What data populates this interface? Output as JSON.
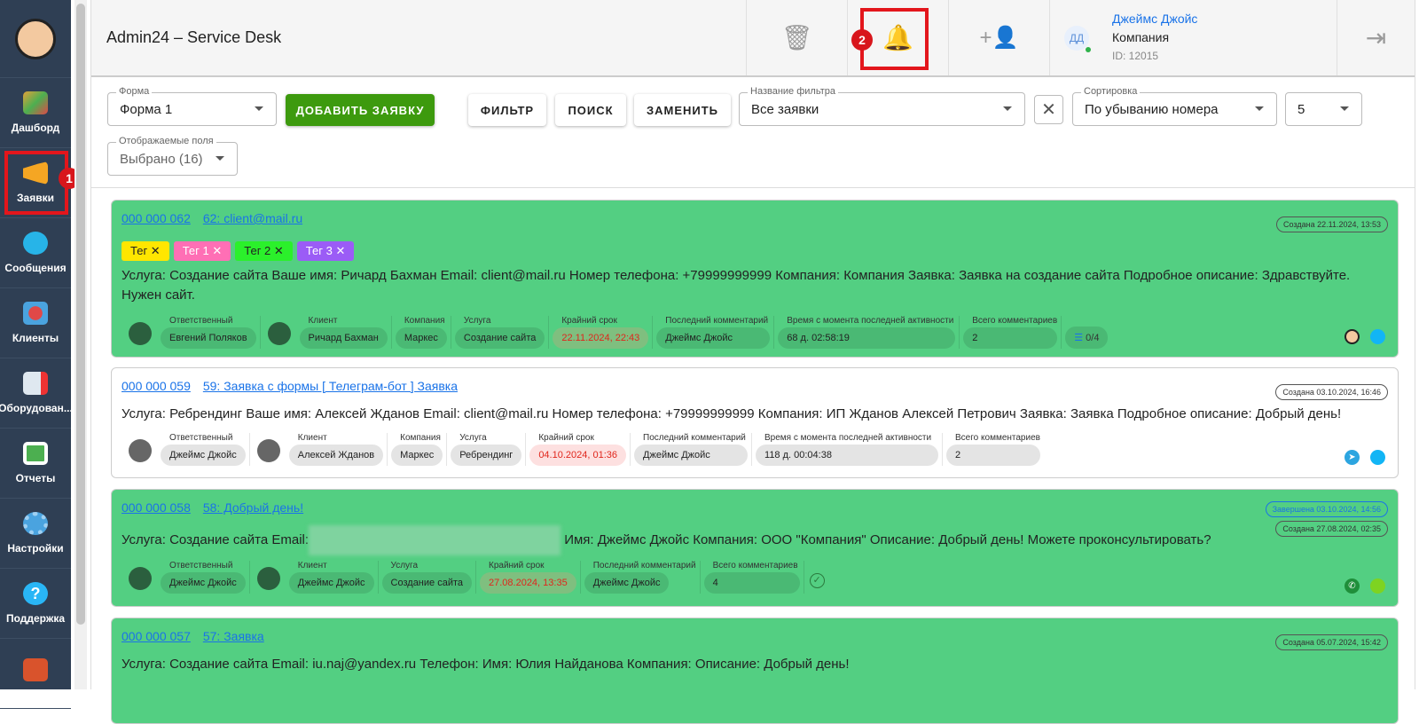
{
  "sidebar": {
    "items": [
      {
        "label": "Дашборд",
        "color": "#e4a13a"
      },
      {
        "label": "Заявки",
        "color": "#f5a623"
      },
      {
        "label": "Сообщения",
        "color": "#27b4e8"
      },
      {
        "label": "Клиенты",
        "color": "#e04848"
      },
      {
        "label": "Оборудован...",
        "color": "#5aa9d9"
      },
      {
        "label": "Отчеты",
        "color": "#4caf50"
      },
      {
        "label": "Настройки",
        "color": "#4aa3df"
      },
      {
        "label": "Поддержка",
        "color": "#29b6f6"
      }
    ],
    "badge1": "1"
  },
  "header": {
    "title": "Admin24 – Service Desk",
    "badge2": "2",
    "user_name": "Джеймс Джойс",
    "company": "Компания",
    "id": "ID: 12015",
    "initials": "ДД"
  },
  "toolbar": {
    "form_label": "Форма",
    "form_value": "Форма 1",
    "add": "ДОБАВИТЬ ЗАЯВКУ",
    "filter": "ФИЛЬТР",
    "search": "ПОИСК",
    "replace": "ЗАМЕНИТЬ",
    "filter_name_label": "Название фильтра",
    "filter_name_value": "Все заявки",
    "sort_label": "Сортировка",
    "sort_value": "По убыванию номера",
    "count": "5",
    "fields_label": "Отображаемые поля",
    "fields_value": "Выбрано (16)"
  },
  "tickets": [
    {
      "num": "000 000 062",
      "title": "62: client@mail.ru",
      "created": "Создана 22.11.2024, 13:53",
      "tags": [
        {
          "label": "Тег",
          "bg": "#ffe600",
          "fg": "#000"
        },
        {
          "label": "Тег 1",
          "bg": "#ff6fb5",
          "fg": "#fff"
        },
        {
          "label": "Тег 2",
          "bg": "#2bf02b",
          "fg": "#000"
        },
        {
          "label": "Тег 3",
          "bg": "#9b5cf6",
          "fg": "#fff"
        }
      ],
      "desc": "Услуга: Создание сайта Ваше имя: Ричард Бахман Email: client@mail.ru Номер телефона: +79999999999 Компания: Компания Заявка: Заявка на создание сайта Подробное описание: Здравствуйте. Нужен сайт.",
      "responsible": "Евгений Поляков",
      "client": "Ричард Бахман",
      "company": "Маркес",
      "service": "Создание сайта",
      "deadline": "22.11.2024, 22:43",
      "last_comment": "Джеймс Джойс",
      "inactive": "68 д. 02:58:19",
      "comments": "2",
      "checklist": "0/4"
    },
    {
      "num": "000 000 059",
      "title": "59: Заявка с формы [ Телеграм-бот ] Заявка",
      "created": "Создана 03.10.2024, 16:46",
      "desc": "Услуга: Ребрендинг Ваше имя: Алексей Жданов Email: client@mail.ru Номер телефона: +79999999999 Компания: ИП Жданов Алексей Петрович Заявка: Заявка Подробное описание: Добрый день!",
      "responsible": "Джеймс Джойс",
      "client": "Алексей Жданов",
      "company": "Маркес",
      "service": "Ребрендинг",
      "deadline": "04.10.2024, 01:36",
      "last_comment": "Джеймс Джойс",
      "inactive": "118 д. 00:04:38",
      "comments": "2"
    },
    {
      "num": "000 000 058",
      "title": "58: Добрый день!",
      "finished": "Завершена 03.10.2024, 14:56",
      "created": "Создана 27.08.2024, 02:35",
      "desc_a": "Услуга: Создание сайта Email:",
      "desc_b": "Имя: Джеймс Джойс Компания: ООО \"Компания\" Описание: Добрый день! Можете проконсультировать?",
      "responsible": "Джеймс Джойс",
      "client": "Джеймс Джойс",
      "service": "Создание сайта",
      "deadline": "27.08.2024, 13:35",
      "last_comment": "Джеймс Джойс",
      "comments": "4"
    },
    {
      "num": "000 000 057",
      "title": "57: Заявка",
      "created": "Создана 05.07.2024, 15:42",
      "desc": "Услуга: Создание сайта Email: iu.naj@yandex.ru Телефон: Имя: Юлия Найданова Компания: Описание: Добрый день!"
    }
  ],
  "labels": {
    "responsible": "Ответственный",
    "client": "Клиент",
    "company": "Компания",
    "service": "Услуга",
    "deadline": "Крайний срок",
    "last_comment": "Последний комментарий",
    "inactive": "Время с момента последней активности",
    "comments": "Всего комментариев"
  }
}
